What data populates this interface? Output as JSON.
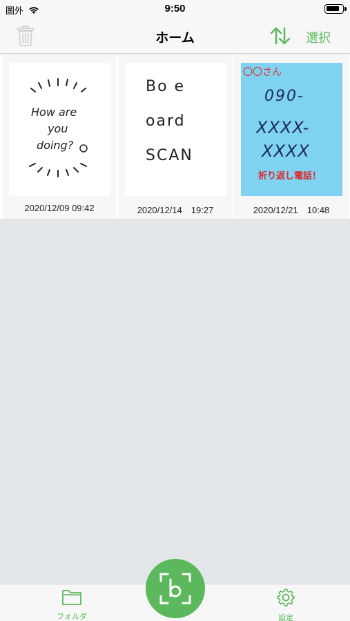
{
  "status": {
    "carrier": "圏外",
    "time": "9:50",
    "battery_level": 0.85
  },
  "nav": {
    "title": "ホーム",
    "select_label": "選択",
    "icons": [
      "trash-icon",
      "sort-icon"
    ]
  },
  "documents": [
    {
      "date": "2020/12/09 09:42",
      "lines": [
        "How are",
        "you",
        "doing?"
      ]
    },
    {
      "date": "2020/12/14　19:27",
      "lines": [
        "Bo  e",
        "  oard",
        "SCAN"
      ]
    },
    {
      "date": "2020/12/21　10:48",
      "lines": [
        "〇〇さん",
        "090-",
        "XXXX-",
        "XXXX",
        "折り返し電話！"
      ]
    }
  ],
  "tabs": {
    "folder_label": "フォルダ",
    "settings_label": "設定"
  },
  "colors": {
    "accent": "#5cb85c",
    "background": "#e3e7ea",
    "note_blue": "#7fd3f0",
    "note_red": "#e0262a"
  }
}
